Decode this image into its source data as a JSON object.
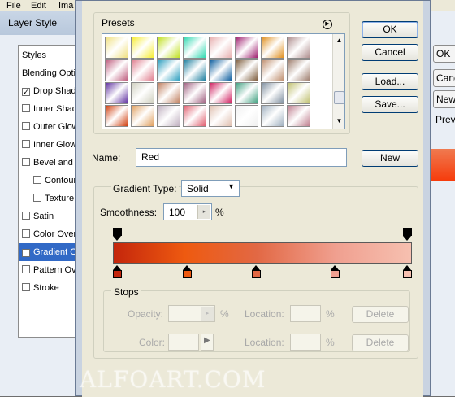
{
  "menubar": {
    "items": [
      "File",
      "Edit",
      "Ima"
    ]
  },
  "layer_style": {
    "title": "Layer Style",
    "styles_header": "Styles",
    "items": [
      {
        "label": "Blending Options",
        "checkbox": false,
        "checked": false,
        "selected": false,
        "indent": false
      },
      {
        "label": "Drop Shadow",
        "checkbox": true,
        "checked": true,
        "selected": false,
        "indent": false
      },
      {
        "label": "Inner Shadow",
        "checkbox": true,
        "checked": false,
        "selected": false,
        "indent": false
      },
      {
        "label": "Outer Glow",
        "checkbox": true,
        "checked": false,
        "selected": false,
        "indent": false
      },
      {
        "label": "Inner Glow",
        "checkbox": true,
        "checked": false,
        "selected": false,
        "indent": false
      },
      {
        "label": "Bevel and Emboss",
        "checkbox": true,
        "checked": false,
        "selected": false,
        "indent": false
      },
      {
        "label": "Contour",
        "checkbox": true,
        "checked": false,
        "selected": false,
        "indent": true
      },
      {
        "label": "Texture",
        "checkbox": true,
        "checked": false,
        "selected": false,
        "indent": true
      },
      {
        "label": "Satin",
        "checkbox": true,
        "checked": false,
        "selected": false,
        "indent": false
      },
      {
        "label": "Color Overlay",
        "checkbox": true,
        "checked": false,
        "selected": false,
        "indent": false
      },
      {
        "label": "Gradient Overlay",
        "checkbox": true,
        "checked": true,
        "selected": true,
        "indent": false
      },
      {
        "label": "Pattern Overlay",
        "checkbox": true,
        "checked": false,
        "selected": false,
        "indent": false
      },
      {
        "label": "Stroke",
        "checkbox": true,
        "checked": false,
        "selected": false,
        "indent": false
      }
    ],
    "right_buttons": [
      "OK",
      "Cancel",
      "New Style...",
      "Preview"
    ]
  },
  "gradient_editor": {
    "presets_label": "Presets",
    "ok_label": "OK",
    "cancel_label": "Cancel",
    "load_label": "Load...",
    "save_label": "Save...",
    "name_label": "Name:",
    "name_value": "Red",
    "new_label": "New",
    "gradient_type_label": "Gradient Type:",
    "gradient_type_value": "Solid",
    "smoothness_label": "Smoothness:",
    "smoothness_value": "100",
    "smoothness_unit": "%",
    "stops_label": "Stops",
    "opacity_label": "Opacity:",
    "color_label": "Color:",
    "location_label": "Location:",
    "percent": "%",
    "delete_label": "Delete",
    "gradient_colors": [
      "#c4260c",
      "#ee4a0c",
      "#fa6a1e",
      "#f0886a",
      "#f8b8a8"
    ],
    "color_stops": [
      {
        "location": 0,
        "color": "#c4260c"
      },
      {
        "location": 24,
        "color": "#ee5a10"
      },
      {
        "location": 48,
        "color": "#e26844"
      },
      {
        "location": 75,
        "color": "#f0a090"
      },
      {
        "location": 100,
        "color": "#f6c0b0"
      }
    ],
    "opacity_stops": [
      0,
      100
    ],
    "presets": [
      [
        "#f0e080",
        "#f6ec30",
        "#c0e020",
        "#30d8b0",
        "#e8b0b0",
        "#a02070",
        "#e09020",
        "#b09090"
      ],
      [
        "#c06080",
        "#e08090",
        "#30a0c0",
        "#2080a0",
        "#1060a0",
        "#806040",
        "#c09070",
        "#a08070"
      ],
      [
        "#6030a0",
        "#d0d0c0",
        "#c08060",
        "#a06080",
        "#d02060",
        "#40a080",
        "#8090a0",
        "#c0c070"
      ],
      [
        "#d04010",
        "#e0a060",
        "#c0b0c0",
        "#e06070",
        "#e0c0b0",
        "#f0f0f0",
        "#a0b0c0",
        "#c08090"
      ]
    ]
  },
  "watermark": "ALFOART.COM"
}
